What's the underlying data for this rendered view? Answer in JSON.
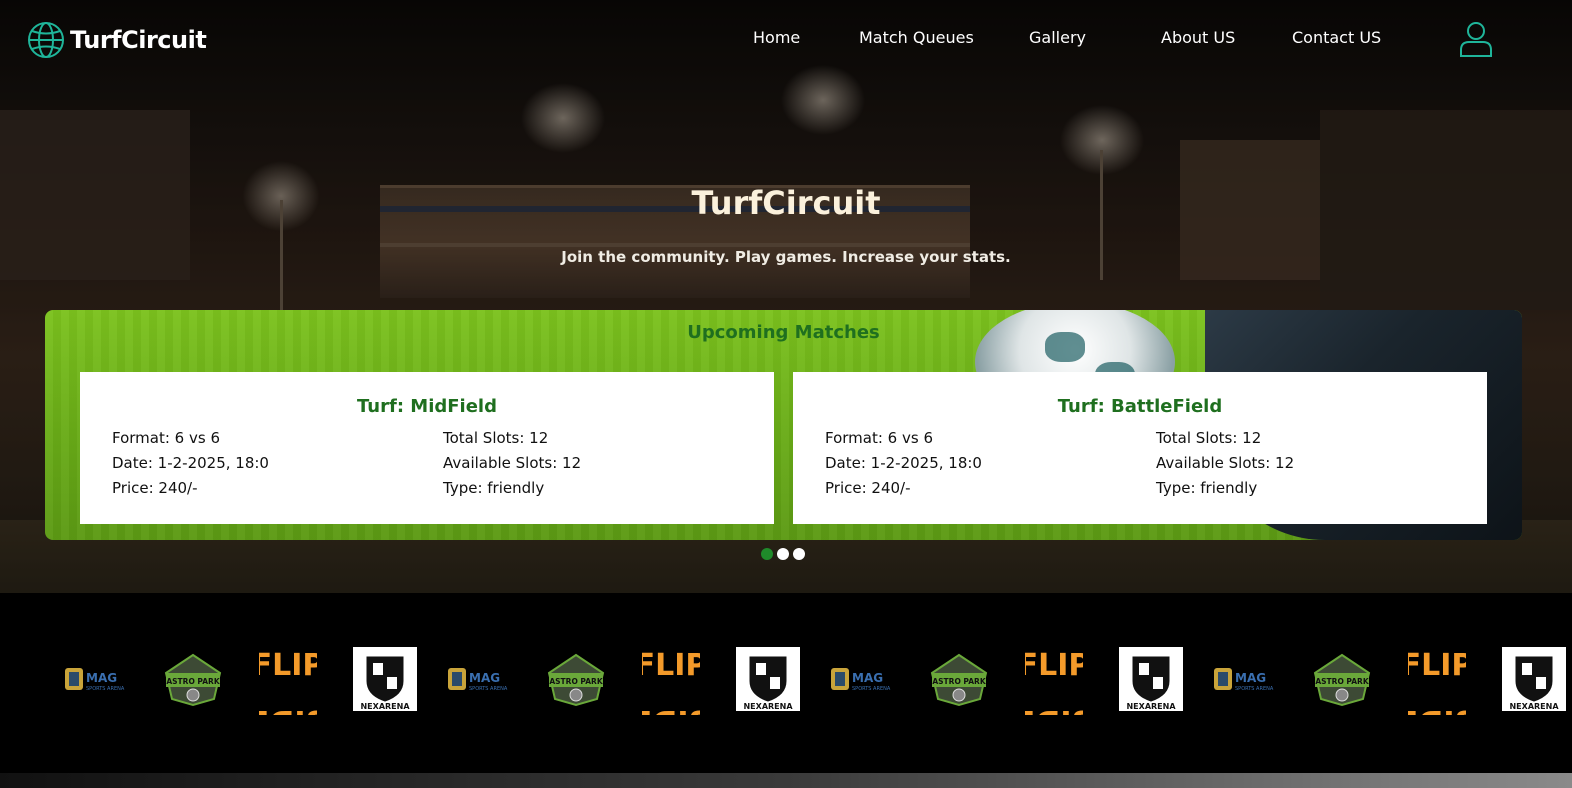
{
  "brand": {
    "name": "TurfCircuit"
  },
  "nav": {
    "items": [
      {
        "label": "Home"
      },
      {
        "label": "Match Queues"
      },
      {
        "label": "Gallery"
      },
      {
        "label": "About US"
      },
      {
        "label": "Contact US"
      }
    ]
  },
  "hero": {
    "title": "TurfCircuit",
    "subtitle": "Join the community. Play games. Increase your stats."
  },
  "matches": {
    "heading": "Upcoming Matches",
    "cards": [
      {
        "title": "Turf: MidField",
        "format": "Format: 6 vs 6",
        "date": "Date: 1-2-2025, 18:0",
        "price": "Price: 240/-",
        "total_slots": "Total Slots: 12",
        "available_slots": "Available Slots: 12",
        "type": "Type: friendly"
      },
      {
        "title": "Turf: BattleField",
        "format": "Format: 6 vs 6",
        "date": "Date: 1-2-2025, 18:0",
        "price": "Price: 240/-",
        "total_slots": "Total Slots: 12",
        "available_slots": "Available Slots: 12",
        "type": "Type: friendly"
      }
    ],
    "carousel": {
      "count": 3,
      "active": 1
    }
  },
  "sponsors": {
    "logos": [
      {
        "name": "mag-logo",
        "text": "MAG",
        "subtext": "SPORTS ARENA"
      },
      {
        "name": "astro-park-logo",
        "text": "ASTRO PARK"
      },
      {
        "name": "flip-side-logo",
        "text": "FLIP SIDE"
      },
      {
        "name": "nex-arena-logo",
        "text": "NEXARENA"
      }
    ]
  },
  "colors": {
    "accent": "#1f6f1f",
    "icon_teal": "#1fb59a",
    "flip_orange": "#f39a2a",
    "astro_green": "#6aa83a"
  }
}
